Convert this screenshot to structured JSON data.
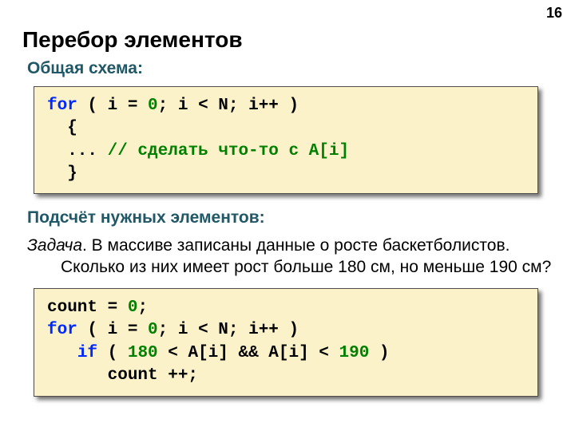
{
  "pagenum": "16",
  "title": "Перебор элементов",
  "sub1": "Общая схема:",
  "code1": {
    "for": "for",
    "l1a": " ( i",
    "eq1": " = ",
    "zero1": "0",
    "l1b": "; i",
    "lt1": " < ",
    "l1c": "N; i++ )",
    "l2": "  {",
    "l3a": "  ... ",
    "l3b": "// сделать что-то с A[i]",
    "l4": "  }"
  },
  "sub2": "Подсчёт нужных элементов:",
  "task_label": "Задача",
  "task_text": ". В массиве записаны данные о росте баскетболистов. Сколько из них имеет рост больше 180 см, но меньше 190 см?",
  "code2": {
    "l1a": "count",
    "eq0": " = ",
    "zero0": "0",
    "l1b": ";",
    "for": "for",
    "l2a": " ( i",
    "eq1": " = ",
    "zero1": "0",
    "l2b": "; i",
    "lt1": " < ",
    "l2c": "N; i++ )",
    "if": "if",
    "l3a": " ( ",
    "n180": "180",
    "l3b": " < ",
    "l3c": "A[i] && A[i]",
    "l3d": " < ",
    "n190": "190",
    "l3e": " )",
    "l4": "      count ++;"
  }
}
